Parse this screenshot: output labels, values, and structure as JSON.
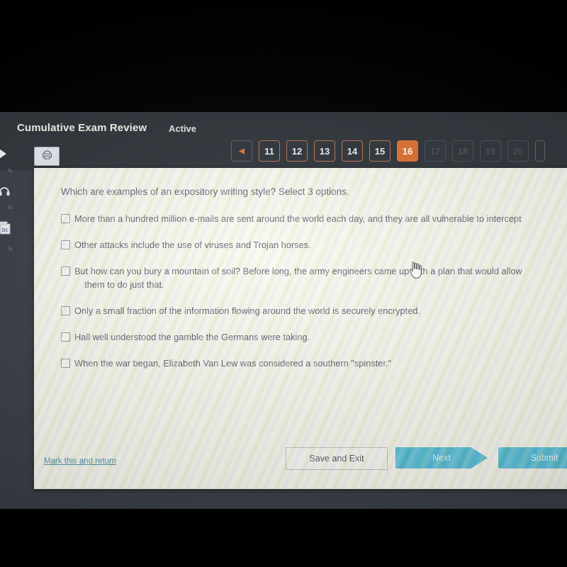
{
  "header": {
    "exam_title": "Cumulative Exam Review",
    "status": "Active",
    "print_icon": "printer-icon"
  },
  "pager": {
    "prev_label": "◀",
    "pages": [
      {
        "label": "11",
        "state": "available"
      },
      {
        "label": "12",
        "state": "available"
      },
      {
        "label": "13",
        "state": "available"
      },
      {
        "label": "14",
        "state": "available"
      },
      {
        "label": "15",
        "state": "available"
      },
      {
        "label": "16",
        "state": "current"
      },
      {
        "label": "17",
        "state": "disabled"
      },
      {
        "label": "18",
        "state": "disabled"
      },
      {
        "label": "19",
        "state": "disabled"
      },
      {
        "label": "20",
        "state": "disabled"
      }
    ],
    "current_page": "16",
    "accent_color": "#e8712c"
  },
  "question": {
    "prompt": "Which are examples of an expository writing style? Select 3 options.",
    "options": [
      {
        "text": "More than a hundred million e-mails are sent around the world each day, and they are all vulnerable to intercept",
        "checked": false,
        "truncated": true
      },
      {
        "text": "Other attacks include the use of viruses and Trojan horses.",
        "checked": false
      },
      {
        "text": "But how can you bury a mountain of soil? Before long, the army engineers came up with a plan that would allow\n    them to do just that.",
        "checked": false
      },
      {
        "text": "Only a small fraction of the information flowing around the world is securely encrypted.",
        "checked": false
      },
      {
        "text": "Hall well understood the gamble the Germans were taking.",
        "checked": false
      },
      {
        "text": "When the war began, Elizabeth Van Lew was considered a southern \"spinster.\"",
        "checked": false
      }
    ]
  },
  "footer": {
    "mark_and_return": "Mark this and return",
    "save_and_exit": "Save and Exit",
    "next": "Next",
    "submit": "Submit",
    "button_color": "#4ec3e0"
  },
  "left_rail": {
    "items": [
      {
        "icon": "chevron-right-icon"
      },
      {
        "icon": "headphones-icon"
      },
      {
        "icon": "abc-document-icon",
        "label": "bc"
      }
    ]
  },
  "taskbar": {
    "search_placeholder": "",
    "items": [
      {
        "icon": "cortana-icon",
        "active": false
      },
      {
        "icon": "task-view-icon",
        "active": false
      },
      {
        "icon": "file-explorer-icon",
        "active": false
      },
      {
        "icon": "microsoft-store-icon",
        "active": false
      },
      {
        "icon": "store-bag-icon",
        "active": false
      },
      {
        "icon": "mail-icon",
        "active": false
      },
      {
        "icon": "dropbox-icon",
        "active": false
      },
      {
        "icon": "office-icon",
        "active": false
      },
      {
        "icon": "lightning-icon",
        "active": false
      },
      {
        "icon": "microsoft-edge-icon",
        "active": true
      },
      {
        "icon": "photos-icon",
        "active": false
      },
      {
        "icon": "amazon-icon",
        "active": false
      }
    ]
  }
}
